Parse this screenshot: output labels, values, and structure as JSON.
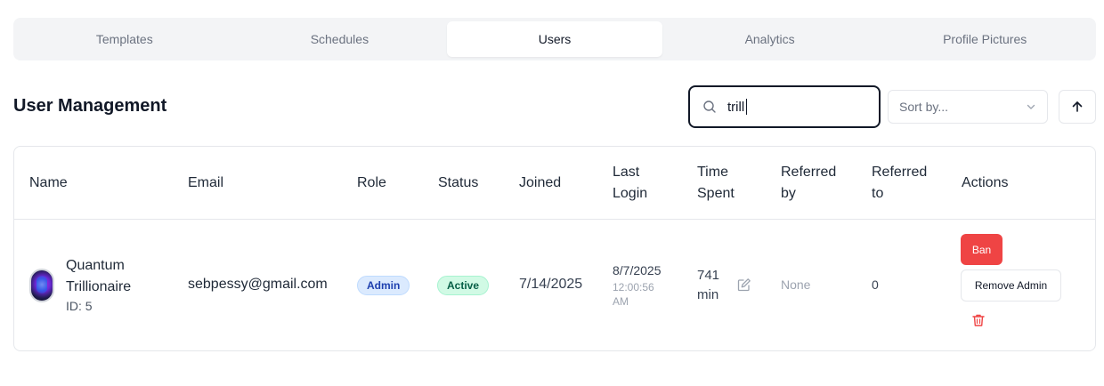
{
  "tabs": [
    {
      "label": "Templates",
      "active": false
    },
    {
      "label": "Schedules",
      "active": false
    },
    {
      "label": "Users",
      "active": true
    },
    {
      "label": "Analytics",
      "active": false
    },
    {
      "label": "Profile Pictures",
      "active": false
    }
  ],
  "page_title": "User Management",
  "search": {
    "value": "trill",
    "icon": "search-icon"
  },
  "sort": {
    "placeholder": "Sort by...",
    "icon": "chevron-down-icon",
    "direction_icon": "arrow-up-icon"
  },
  "table": {
    "headers": {
      "name": "Name",
      "email": "Email",
      "role": "Role",
      "status": "Status",
      "joined": "Joined",
      "last_login_1": "Last",
      "last_login_2": "Login",
      "time_spent_1": "Time",
      "time_spent_2": "Spent",
      "referred_by_1": "Referred",
      "referred_by_2": "by",
      "referred_to_1": "Referred",
      "referred_to_2": "to",
      "actions": "Actions"
    },
    "rows": [
      {
        "name_line1": "Quantum",
        "name_line2": "Trillionaire",
        "id": "ID: 5",
        "email": "sebpessy@gmail.com",
        "role": "Admin",
        "status": "Active",
        "joined": "7/14/2025",
        "last_login_date": "8/7/2025",
        "last_login_time_1": "12:00:56",
        "last_login_time_2": "AM",
        "time_spent_1": "741",
        "time_spent_2": "min",
        "referred_by": "None",
        "referred_to": "0",
        "actions": {
          "ban": "Ban",
          "remove_admin": "Remove Admin",
          "delete_icon": "trash-icon",
          "edit_icon": "edit-icon"
        }
      }
    ]
  },
  "colors": {
    "danger": "#ef4444",
    "admin_badge_bg": "#dbeafe",
    "active_badge_bg": "#d1fae5"
  }
}
